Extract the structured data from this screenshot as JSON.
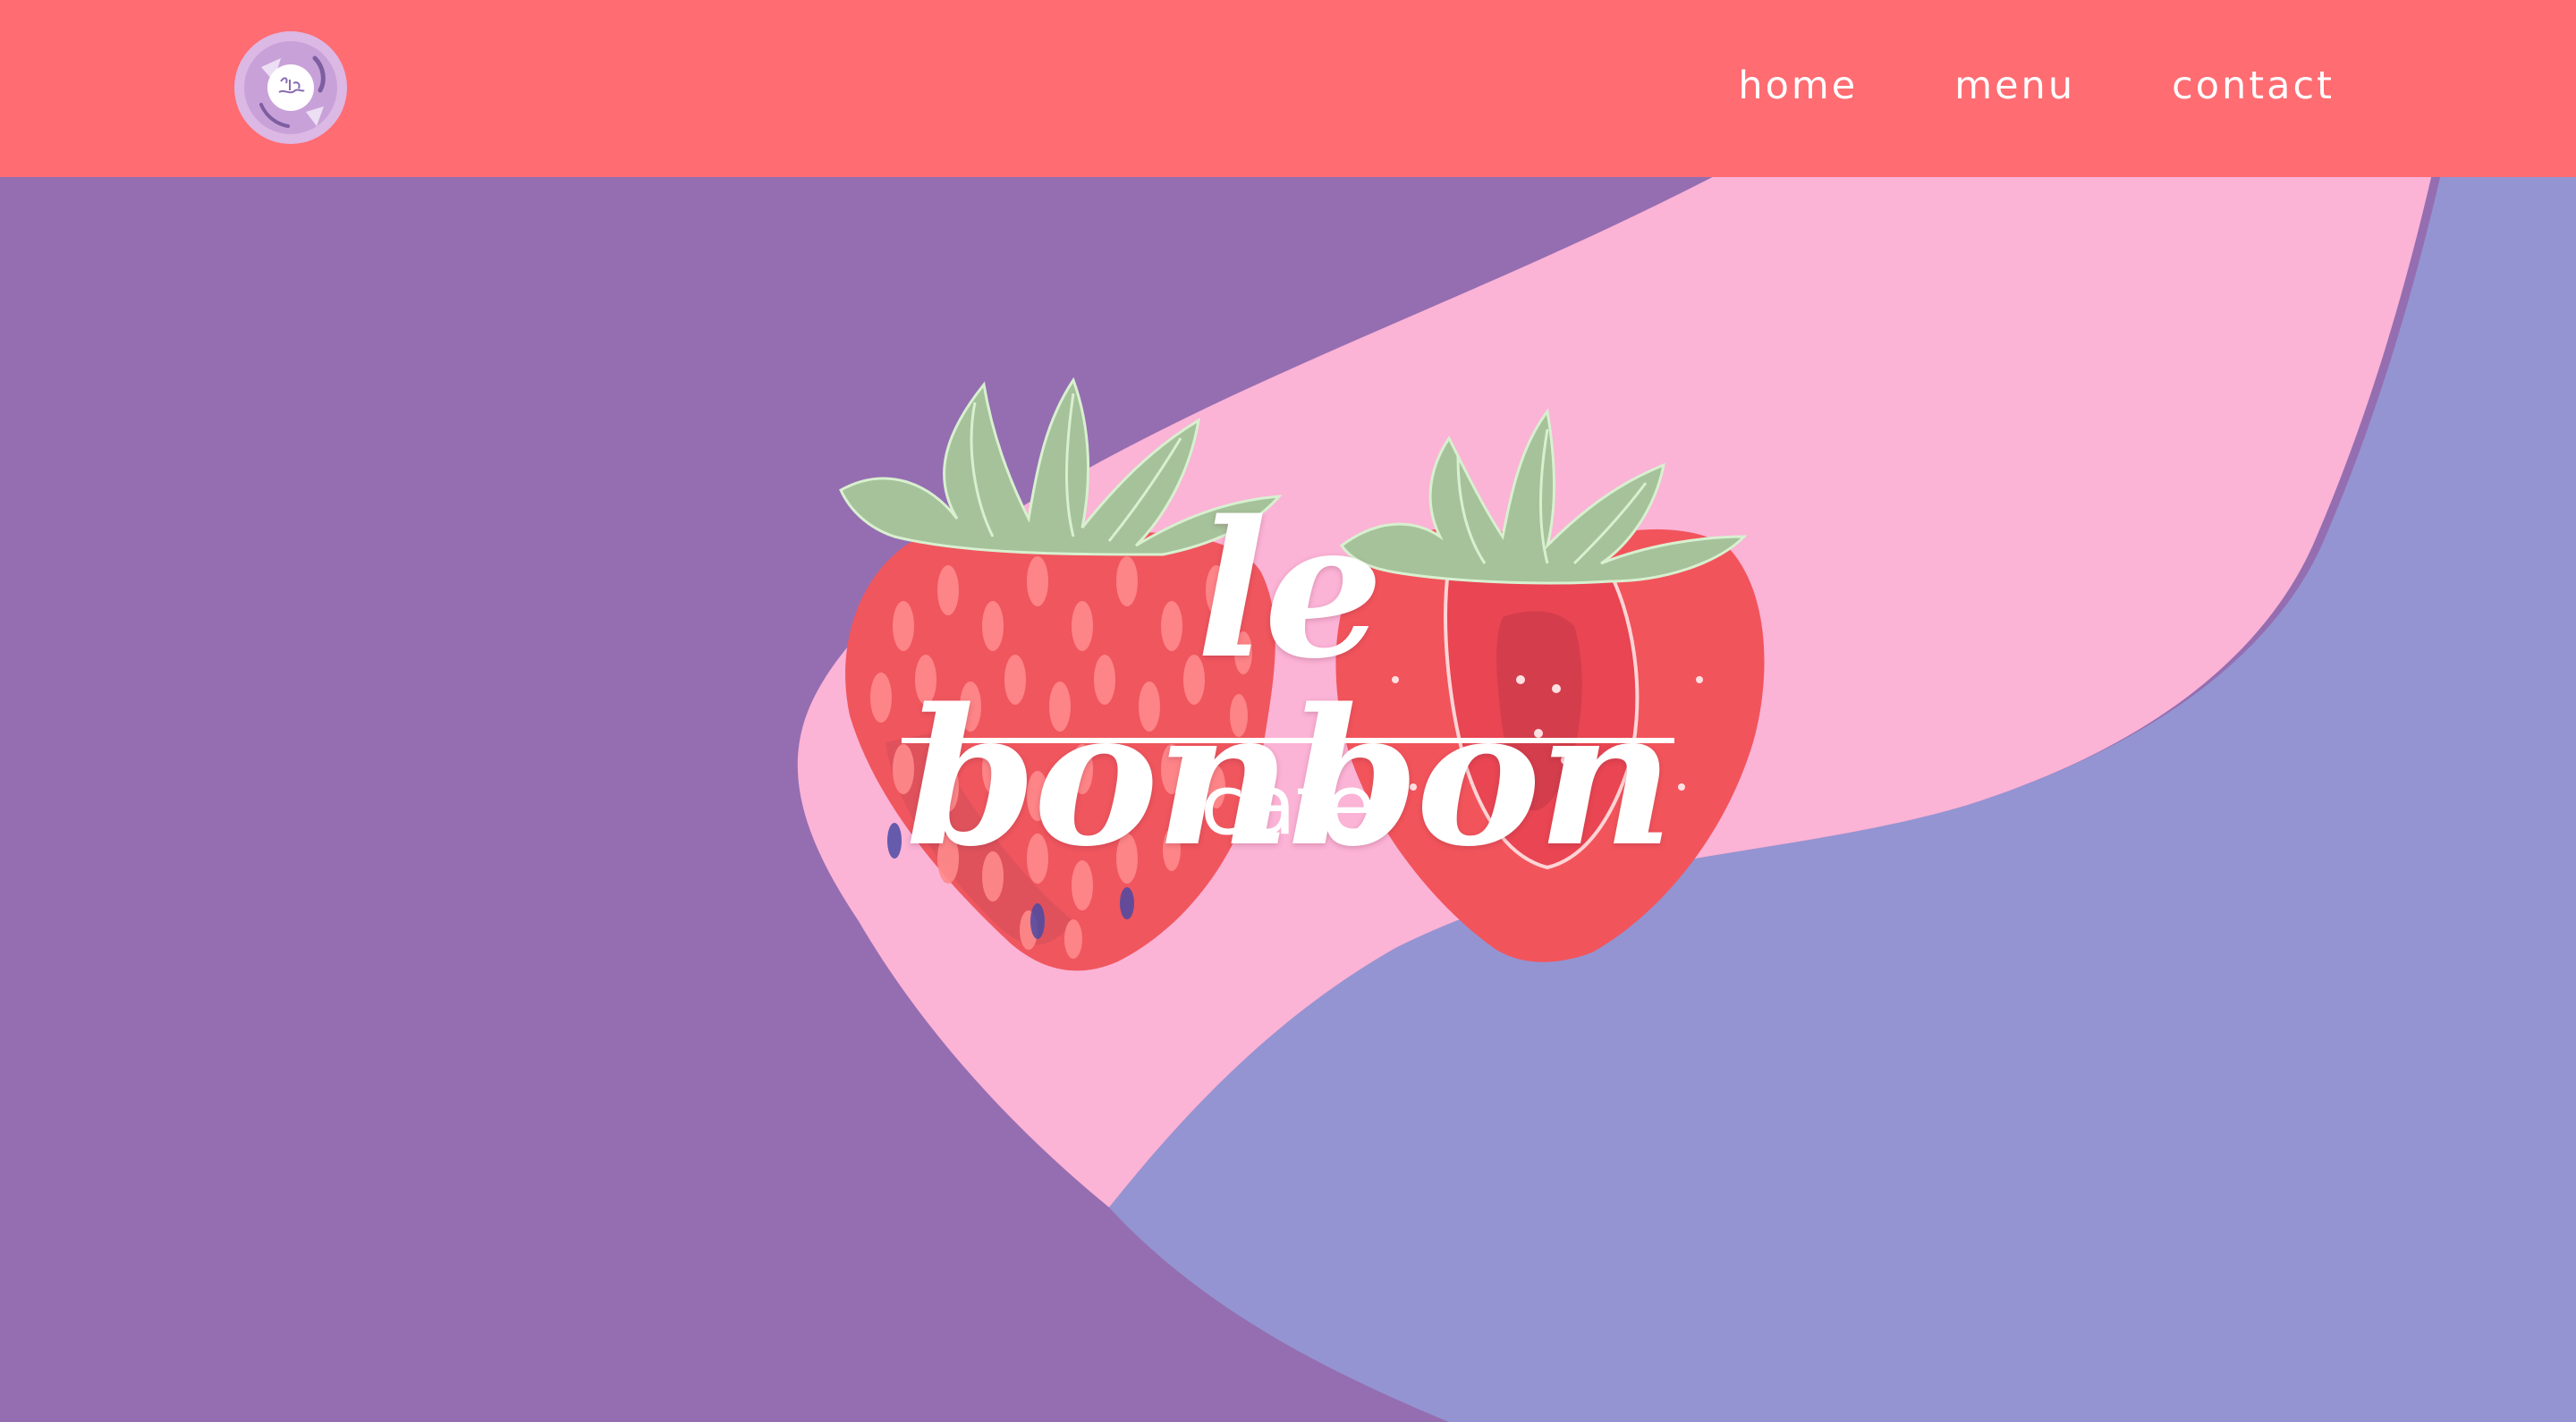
{
  "nav": {
    "logo_alt": "le bonbon",
    "items": [
      {
        "label": "home"
      },
      {
        "label": "menu"
      },
      {
        "label": "contact"
      }
    ]
  },
  "hero": {
    "title": "le bonbon",
    "subtitle": "cafe"
  },
  "colors": {
    "navbar": "#ff6c72",
    "purple": "#956eb1",
    "pink": "#fbb3d6",
    "lavender": "#9494d2",
    "text": "#ffffff"
  }
}
